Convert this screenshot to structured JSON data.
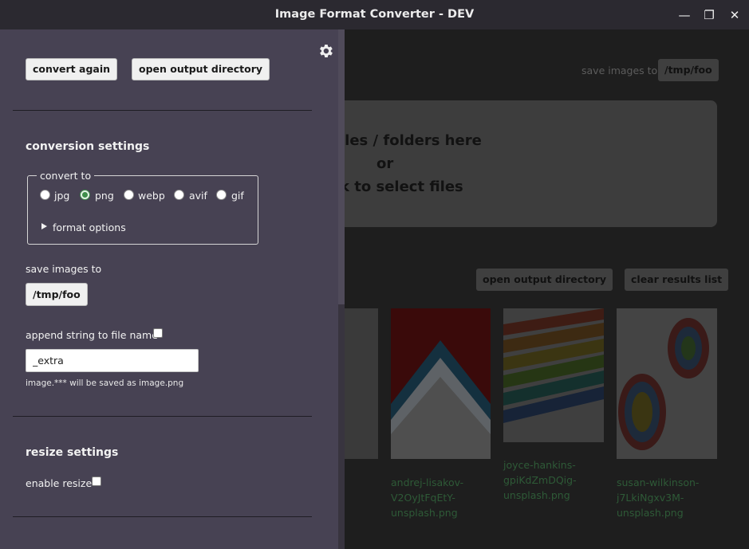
{
  "window": {
    "title": "Image Format Converter - DEV",
    "controls": {
      "minimize": "—",
      "restore": "❐",
      "close": "✕"
    }
  },
  "main": {
    "save_label": "save images to",
    "save_path": "/tmp/foo",
    "drop_lines": [
      "iles / folders here",
      "or",
      "k to select files"
    ],
    "open_output_button": "open output directory",
    "clear_results_button": "clear results list",
    "results": [
      {
        "caption": [
          "andrej-lisakov-",
          "V2OyJtFqEtY-",
          "unsplash.png"
        ]
      },
      {
        "caption": [
          "joyce-hankins-",
          "gpiKdZmDQig-",
          "unsplash.png"
        ]
      },
      {
        "caption": [
          "susan-wilkinson-",
          "j7LkiNgxv3M-",
          "unsplash.png"
        ]
      }
    ]
  },
  "sidebar": {
    "convert_again_button": "convert again",
    "open_output_button": "open output directory",
    "conversion": {
      "heading": "conversion settings",
      "legend": "convert to",
      "formats": [
        "jpg",
        "png",
        "webp",
        "avif",
        "gif"
      ],
      "selected_format": "png",
      "format_options_label": "format options"
    },
    "save": {
      "label": "save images to",
      "path_button": "/tmp/foo"
    },
    "append": {
      "label": "append string to file name",
      "value": "_extra",
      "hint": "image.*** will be saved as image.png"
    },
    "resize": {
      "heading": "resize settings",
      "enable_label": "enable resize"
    }
  },
  "colors": {
    "sidebar_bg": "#474253",
    "titlebar_bg": "#2b2930",
    "accent_green": "#3e8e4a"
  }
}
